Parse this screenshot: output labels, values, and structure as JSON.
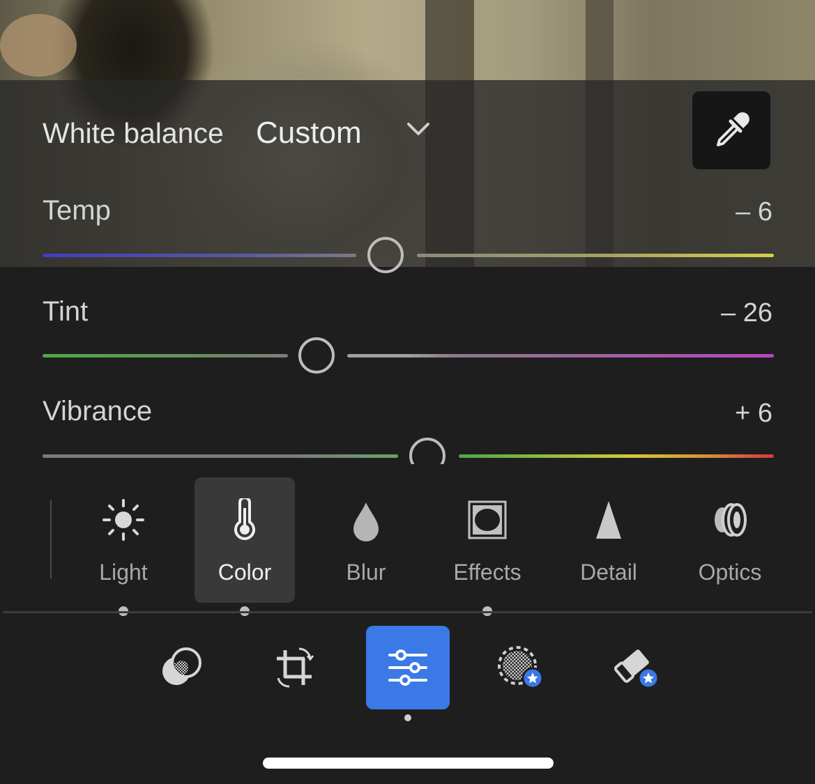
{
  "white_balance": {
    "label": "White balance",
    "value": "Custom"
  },
  "sliders": [
    {
      "label": "Temp",
      "value": "– 6",
      "position": 0.471
    },
    {
      "label": "Tint",
      "value": "– 26",
      "position": 0.377
    },
    {
      "label": "Vibrance",
      "value": "+ 6",
      "position": 0.527
    }
  ],
  "tabs": [
    {
      "label": "Light",
      "icon": "sun-icon"
    },
    {
      "label": "Color",
      "icon": "thermometer-icon"
    },
    {
      "label": "Blur",
      "icon": "droplet-icon"
    },
    {
      "label": "Effects",
      "icon": "vignette-icon"
    },
    {
      "label": "Detail",
      "icon": "triangle-icon"
    },
    {
      "label": "Optics",
      "icon": "lens-icon"
    }
  ],
  "active_tab": "Color",
  "tools": [
    {
      "name": "presets-icon"
    },
    {
      "name": "crop-icon"
    },
    {
      "name": "edit-adjustments-icon"
    },
    {
      "name": "masking-premium-icon"
    },
    {
      "name": "healing-premium-icon"
    }
  ],
  "active_tool": "edit-adjustments-icon",
  "colors": {
    "accent": "#3a79e6",
    "temp_start": "#3d3fc4",
    "temp_end": "#d6cf4a",
    "tint_start": "#4ea845",
    "tint_end": "#b348c0",
    "premium_badge": "#3a79e6"
  }
}
